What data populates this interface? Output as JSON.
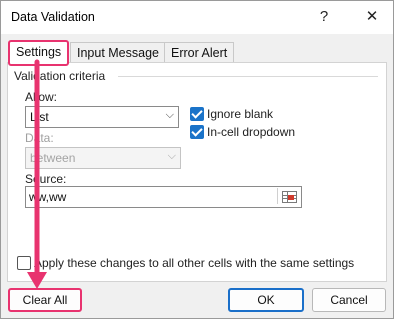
{
  "dialog": {
    "title": "Data Validation",
    "help": "?",
    "close": "✕"
  },
  "tabs": [
    {
      "label": "Settings",
      "active": true
    },
    {
      "label": "Input Message",
      "active": false
    },
    {
      "label": "Error Alert",
      "active": false
    }
  ],
  "criteria": {
    "group_label": "Validation criteria",
    "allow": {
      "label": "Allow:",
      "value": "List"
    },
    "data": {
      "label": "Data:",
      "value": "between",
      "disabled": true
    },
    "ignore_blank": {
      "label": "Ignore blank",
      "checked": true
    },
    "in_cell_dropdown": {
      "label": "In-cell dropdown",
      "checked": true
    },
    "source": {
      "label": "Source:",
      "value": "ww,ww"
    }
  },
  "apply_all": {
    "label": "Apply these changes to all other cells with the same settings",
    "checked": false
  },
  "buttons": {
    "clear_all": "Clear All",
    "ok": "OK",
    "cancel": "Cancel"
  },
  "colors": {
    "highlight": "#e8336f",
    "accent": "#1a73c9"
  }
}
